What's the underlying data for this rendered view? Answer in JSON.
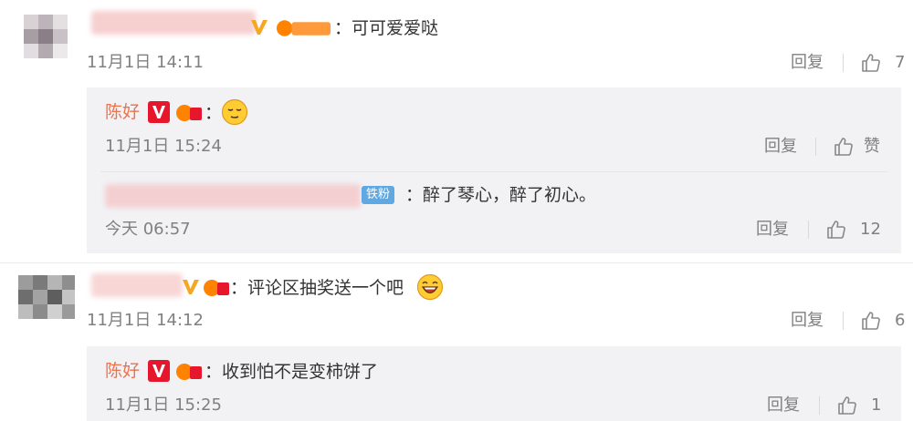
{
  "colors": {
    "accent_name": "#eb7350",
    "meta": "#808080",
    "reply_bg": "#f2f2f5",
    "vip_orange": "#ff8200",
    "vip_red": "#e6162d"
  },
  "comments": [
    {
      "text": "可可爱爱哒",
      "timestamp": "11月1日 14:11",
      "reply_label": "回复",
      "like_count": "7",
      "replies": [
        {
          "name": "陈好",
          "text": "",
          "emoji": "relieved-face-emoji",
          "timestamp": "11月1日 15:24",
          "reply_label": "回复",
          "like_label": "赞"
        },
        {
          "badge_label": "铁粉",
          "text": "醉了琴心，醉了初心。",
          "timestamp": "今天 06:57",
          "reply_label": "回复",
          "like_count": "12"
        }
      ]
    },
    {
      "text": "评论区抽奖送一个吧",
      "emoji": "laughing-face-emoji",
      "timestamp": "11月1日 14:12",
      "reply_label": "回复",
      "like_count": "6",
      "replies": [
        {
          "name": "陈好",
          "text": "收到怕不是变柿饼了",
          "timestamp": "11月1日 15:25",
          "reply_label": "回复",
          "like_count": "1"
        }
      ]
    }
  ]
}
